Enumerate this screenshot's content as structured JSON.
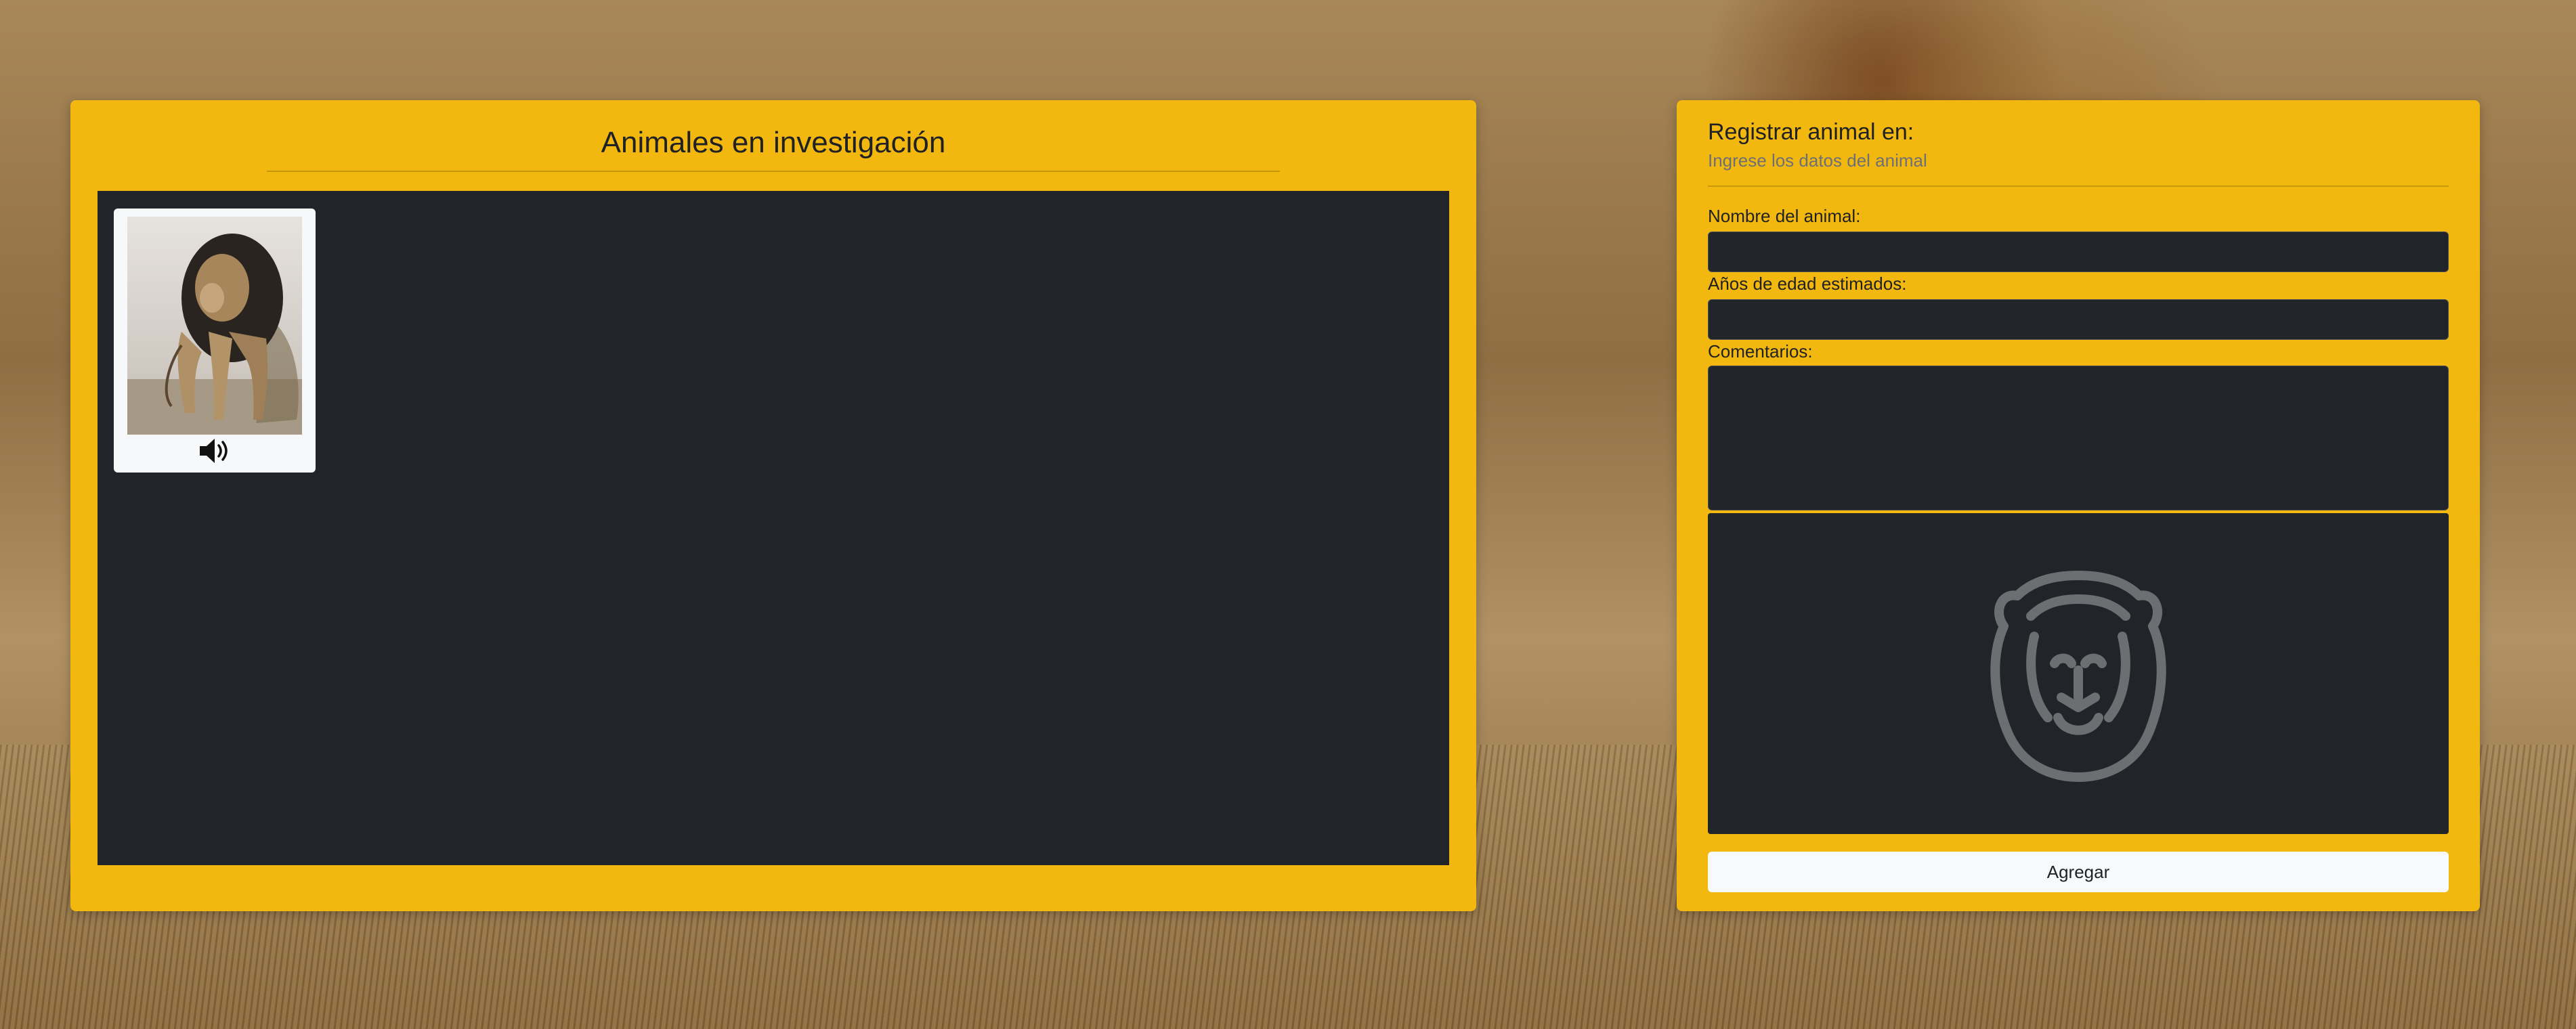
{
  "gallery": {
    "title": "Animales en investigación",
    "card": {
      "icon": "speaker-icon"
    }
  },
  "form": {
    "title": "Registrar animal en:",
    "subtitle": "Ingrese los datos del animal",
    "name_label": "Nombre del animal:",
    "name_value": "",
    "age_label": "Años de edad estimados:",
    "age_value": "",
    "comments_label": "Comentarios:",
    "comments_value": "",
    "preview_icon": "lion-outline-icon",
    "submit_label": "Agregar"
  },
  "colors": {
    "panel": "#f2b80f",
    "dark": "#212429",
    "button": "#f8f9fa"
  }
}
